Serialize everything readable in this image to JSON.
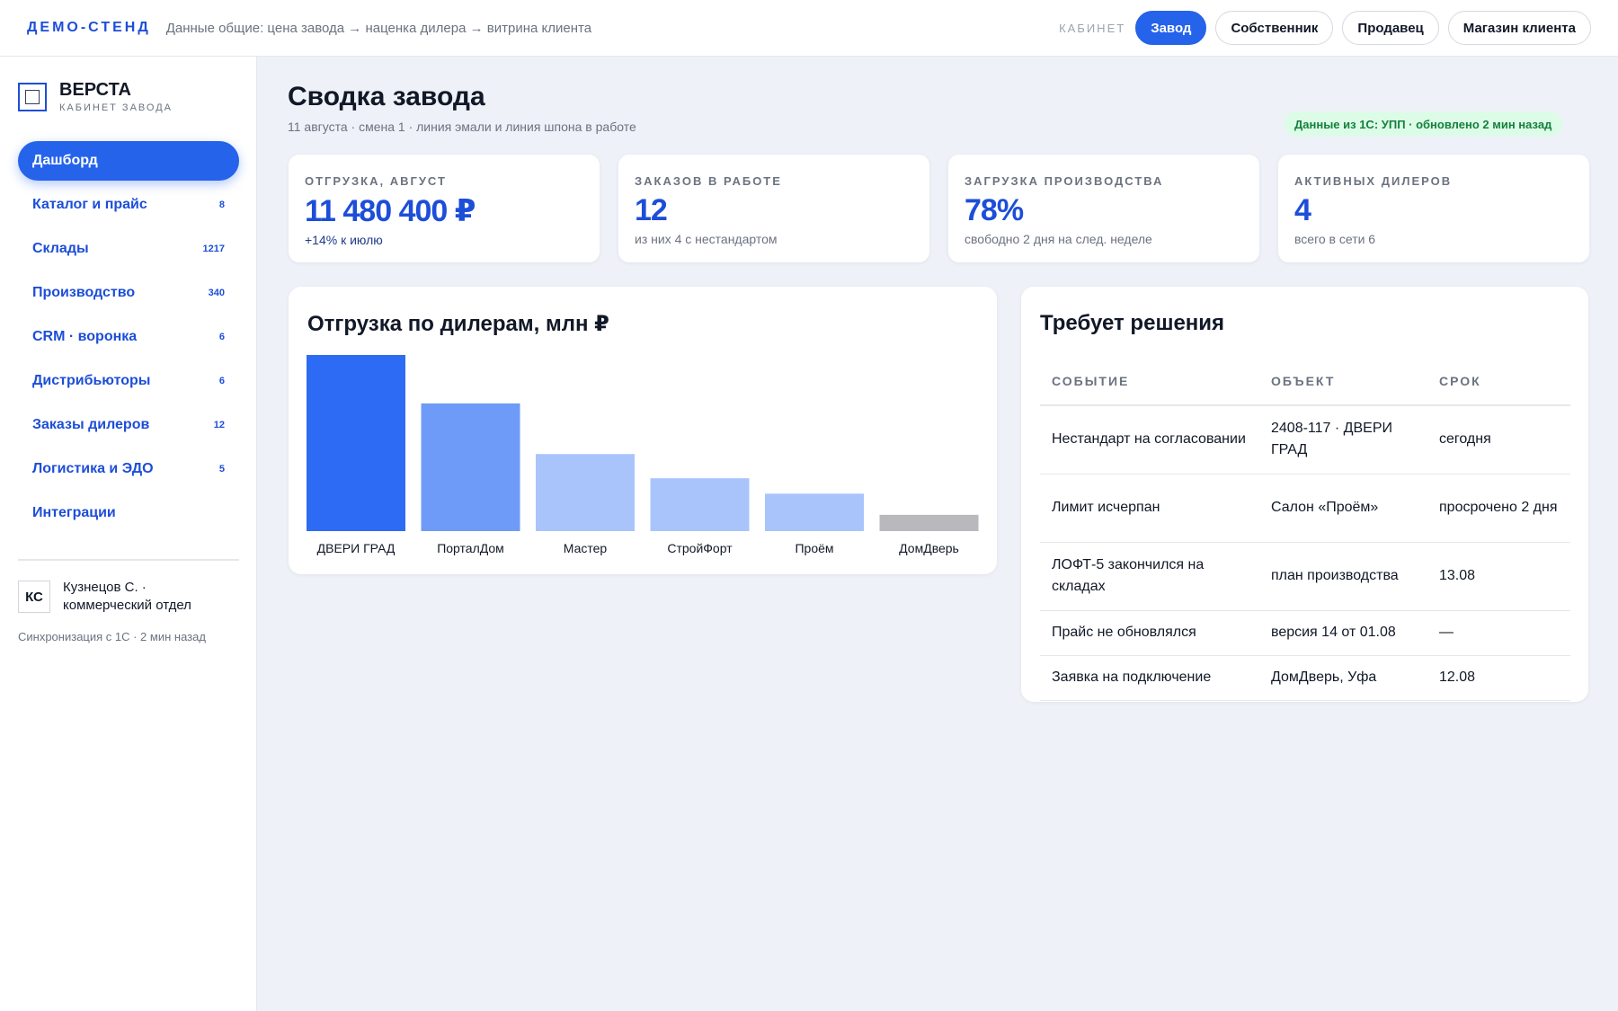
{
  "topbar": {
    "brand": "ДЕМО-СТЕНД",
    "breadcrumb": "Данные общие: цена завода → наценка дилера → витрина клиента",
    "cabinet_label": "КАБИНЕТ",
    "roles": [
      "Завод",
      "Собственник",
      "Продавец",
      "Магазин клиента"
    ],
    "active_role": "Завод"
  },
  "sidebar": {
    "logo_icon": "square-logo-icon",
    "title": "ВЕРСТА",
    "subtitle": "КАБИНЕТ ЗАВОДА",
    "items": [
      {
        "label": "Дашборд",
        "count": "",
        "active": true
      },
      {
        "label": "Каталог и прайс",
        "count": "8"
      },
      {
        "label": "Склады",
        "count": "1217"
      },
      {
        "label": "Производство",
        "count": "340"
      },
      {
        "label": "CRM · воронка",
        "count": "6"
      },
      {
        "label": "Дистрибьюторы",
        "count": "6"
      },
      {
        "label": "Заказы дилеров",
        "count": "12"
      },
      {
        "label": "Логистика и ЭДО",
        "count": "5"
      },
      {
        "label": "Интеграции",
        "count": ""
      }
    ],
    "user": {
      "initials": "КС",
      "name_line1": "Кузнецов С. ·",
      "name_line2": "коммерческий отдел"
    },
    "sync": "Синхронизация с 1С · 2 мин назад"
  },
  "main": {
    "title": "Сводка завода",
    "subtitle": "11 августа · смена 1 · линия эмали и линия шпона в работе",
    "status": "Данные из 1С: УПП · обновлено 2 мин назад"
  },
  "kpis": [
    {
      "label": "ОТГРУЗКА, АВГУСТ",
      "value": "11 480 400 ₽",
      "note": "+14% к июлю"
    },
    {
      "label": "ЗАКАЗОВ В РАБОТЕ",
      "value": "12",
      "note": "из них 4 с нестандартом"
    },
    {
      "label": "ЗАГРУЗКА ПРОИЗВОДСТВА",
      "value": "78%",
      "note": "свободно 2 дня на след. неделе"
    },
    {
      "label": "АКТИВНЫХ ДИЛЕРОВ",
      "value": "4",
      "note": "всего в сети 6"
    }
  ],
  "chart_data": {
    "type": "bar",
    "title": "Отгрузка по дилерам, млн ₽",
    "categories": [
      "ДВЕРИ ГРАД",
      "ПорталДом",
      "Мастер",
      "СтройФорт",
      "Проём",
      "ДомДверь"
    ],
    "values": [
      4.0,
      2.9,
      1.75,
      1.2,
      0.85,
      0.37
    ],
    "colors": [
      "#2d6bf5",
      "#6e9bf7",
      "#a8c4fb",
      "#a8c4fb",
      "#a8c4fb",
      "#b8b8bd"
    ],
    "ylim": [
      0,
      4.0
    ],
    "grid": false,
    "legend": "none"
  },
  "decisions": {
    "title": "Требует решения",
    "headers": [
      "СОБЫТИЕ",
      "ОБЪЕКТ",
      "СРОК"
    ],
    "rows": [
      [
        "Нестандарт на согласовании",
        "2408-117 · ДВЕРИ ГРАД",
        "сегодня"
      ],
      [
        "Лимит исчерпан",
        "Салон «Проём»",
        "просрочено 2 дня"
      ],
      [
        "ЛОФТ-5 закончился на складах",
        "план производства",
        "13.08"
      ],
      [
        "Прайс не обновлялся",
        "версия 14 от 01.08",
        "—"
      ],
      [
        "Заявка на подключение",
        "ДомДверь, Уфа",
        "12.08"
      ]
    ]
  }
}
